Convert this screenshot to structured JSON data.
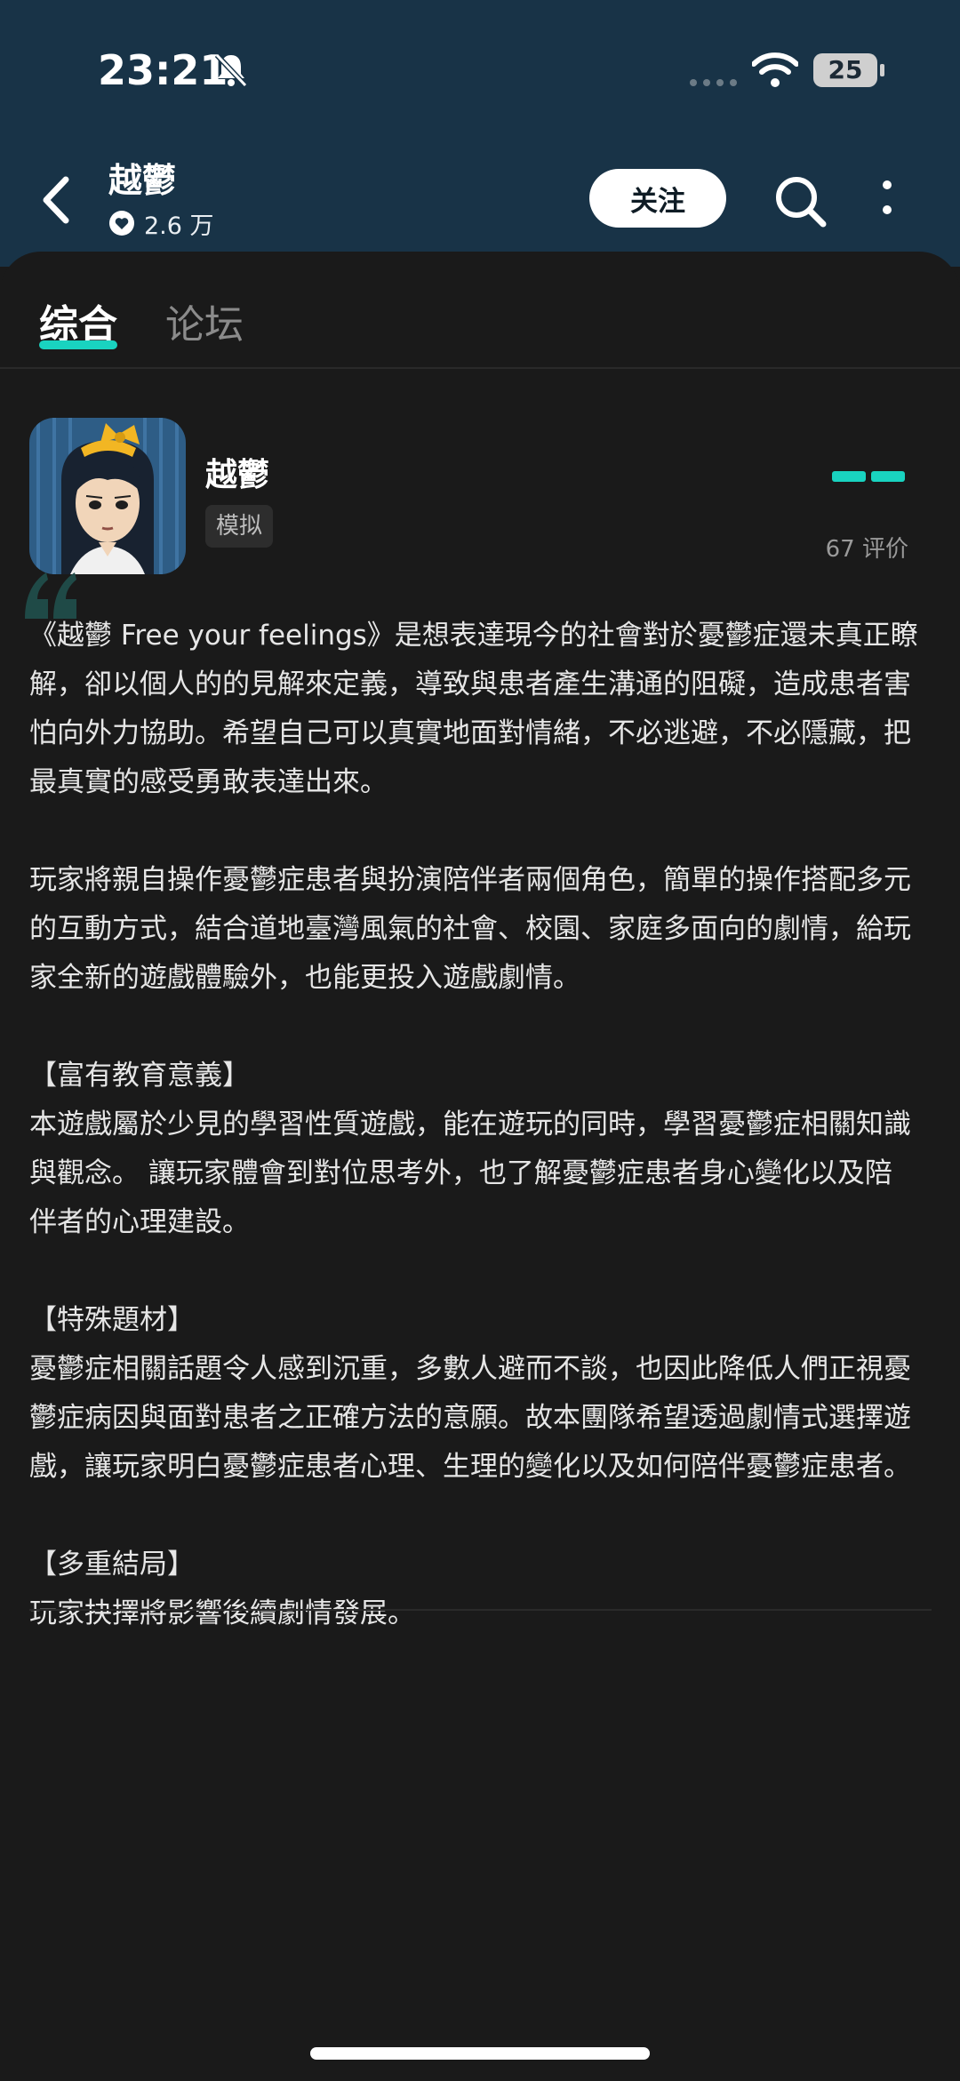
{
  "status_bar": {
    "time": "23:21",
    "battery": "25"
  },
  "header": {
    "title": "越鬱",
    "likes": "2.6 万",
    "follow_label": "关注"
  },
  "tabs": [
    {
      "label": "综合",
      "active": true
    },
    {
      "label": "论坛",
      "active": false
    }
  ],
  "app": {
    "name": "越鬱",
    "tag": "模拟",
    "rating_count": "67 评价"
  },
  "description": {
    "intro_1": "《越鬱 Free your feelings》是想表達現今的社會對於憂鬱症還未真正瞭解，卻以個人的的見解來定義，導致與患者產生溝通的阻礙，造成患者害怕向外力協助。希望自己可以真實地面對情緒，不必逃避，不必隱藏，把最真實的感受勇敢表達出來。",
    "intro_2": "玩家將親自操作憂鬱症患者與扮演陪伴者兩個角色，簡單的操作搭配多元的互動方式，結合道地臺灣風氣的社會、校園、家庭多面向的劇情，給玩家全新的遊戲體驗外，也能更投入遊戲劇情。",
    "section_1_title": "【富有教育意義】",
    "section_1_body": "本遊戲屬於少見的學習性質遊戲，能在遊玩的同時，學習憂鬱症相關知識與觀念。 讓玩家體會到對位思考外，也了解憂鬱症患者身心變化以及陪伴者的心理建設。",
    "section_2_title": "【特殊題材】",
    "section_2_body": "憂鬱症相關話題令人感到沉重，多數人避而不談，也因此降低人們正視憂鬱症病因與面對患者之正確方法的意願。故本團隊希望透過劇情式選擇遊戲，讓玩家明白憂鬱症患者心理、生理的變化以及如何陪伴憂鬱症患者。",
    "section_3_title": "【多重結局】",
    "section_3_body": "玩家抉擇將影響後續劇情發展。"
  },
  "colors": {
    "header_bg": "#183347",
    "accent": "#19d3c0",
    "page_bg": "#1a1a1a"
  }
}
